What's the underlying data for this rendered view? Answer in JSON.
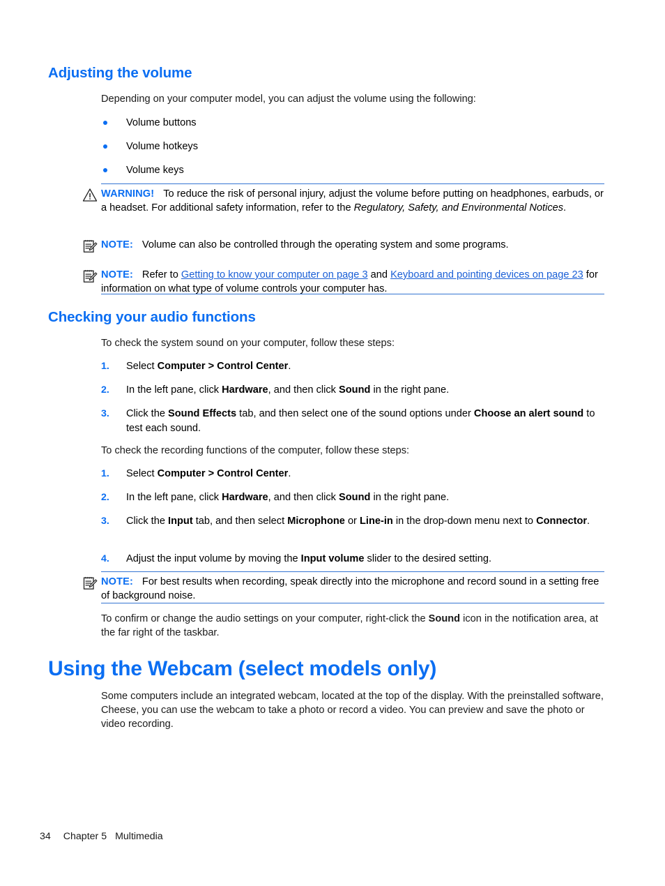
{
  "document": {
    "section1": {
      "heading": "Adjusting the volume",
      "intro": "Depending on your computer model, you can adjust the volume using the following:",
      "bullets": [
        "Volume buttons",
        "Volume hotkeys",
        "Volume keys"
      ],
      "warning": {
        "label": "WARNING!",
        "text_before_italic": "To reduce the risk of personal injury, adjust the volume before putting on headphones, earbuds, or a headset. For additional safety information, refer to the ",
        "italic_title": "Regulatory, Safety, and Environmental Notices",
        "text_after_italic": "."
      },
      "note1": {
        "label": "NOTE:",
        "text": "Volume can also be controlled through the operating system and some programs."
      },
      "note2": {
        "label": "NOTE:",
        "text_1": "Refer to ",
        "link_1": "Getting to know your computer on page 3",
        "text_2": " and ",
        "link_2": "Keyboard and pointing devices on page 23",
        "text_3": " for information on what type of volume controls your computer has."
      }
    },
    "section2": {
      "heading": "Checking your audio functions",
      "intro_system": "To check the system sound on your computer, follow these steps:",
      "steps_system": [
        {
          "num": "1.",
          "parts": [
            {
              "t": "Select ",
              "b": false
            },
            {
              "t": "Computer > Control Center",
              "b": true
            },
            {
              "t": ".",
              "b": false
            }
          ]
        },
        {
          "num": "2.",
          "parts": [
            {
              "t": "In the left pane, click ",
              "b": false
            },
            {
              "t": "Hardware",
              "b": true
            },
            {
              "t": ", and then click ",
              "b": false
            },
            {
              "t": "Sound",
              "b": true
            },
            {
              "t": " in the right pane.",
              "b": false
            }
          ]
        },
        {
          "num": "3.",
          "parts": [
            {
              "t": "Click the ",
              "b": false
            },
            {
              "t": "Sound Effects",
              "b": true
            },
            {
              "t": " tab, and then select one of the sound options under ",
              "b": false
            },
            {
              "t": "Choose an alert sound",
              "b": true
            },
            {
              "t": " to test each sound.",
              "b": false
            }
          ]
        }
      ],
      "intro_recording": "To check the recording functions of the computer, follow these steps:",
      "steps_recording": [
        {
          "num": "1.",
          "parts": [
            {
              "t": "Select ",
              "b": false
            },
            {
              "t": "Computer > Control Center",
              "b": true
            },
            {
              "t": ".",
              "b": false
            }
          ]
        },
        {
          "num": "2.",
          "parts": [
            {
              "t": "In the left pane, click ",
              "b": false
            },
            {
              "t": "Hardware",
              "b": true
            },
            {
              "t": ", and then click ",
              "b": false
            },
            {
              "t": "Sound",
              "b": true
            },
            {
              "t": " in the right pane.",
              "b": false
            }
          ]
        },
        {
          "num": "3.",
          "parts": [
            {
              "t": "Click the ",
              "b": false
            },
            {
              "t": "Input",
              "b": true
            },
            {
              "t": " tab, and then select ",
              "b": false
            },
            {
              "t": "Microphone",
              "b": true
            },
            {
              "t": " or ",
              "b": false
            },
            {
              "t": "Line-in",
              "b": true
            },
            {
              "t": " in the drop-down menu next to ",
              "b": false
            },
            {
              "t": "Connector",
              "b": true
            },
            {
              "t": ".",
              "b": false
            }
          ]
        },
        {
          "num": "4.",
          "parts": [
            {
              "t": "Adjust the input volume by moving the ",
              "b": false
            },
            {
              "t": "Input volume",
              "b": true
            },
            {
              "t": " slider to the desired setting.",
              "b": false
            }
          ]
        }
      ],
      "note3": {
        "label": "NOTE:",
        "text": "For best results when recording, speak directly into the microphone and record sound in a setting free of background noise."
      },
      "closing": {
        "parts": [
          {
            "t": "To confirm or change the audio settings on your computer, right-click the ",
            "b": false
          },
          {
            "t": "Sound",
            "b": true
          },
          {
            "t": " icon in the notification area, at the far right of the taskbar.",
            "b": false
          }
        ]
      }
    },
    "section3": {
      "heading": "Using the Webcam (select models only)",
      "paragraph": "Some computers include an integrated webcam, located at the top of the display. With the preinstalled software, Cheese, you can use the webcam to take a photo or record a video. You can preview and save the photo or video recording."
    },
    "footer": {
      "page_number": "34",
      "chapter": "Chapter 5",
      "chapter_title": "Multimedia"
    },
    "colors": {
      "accent_blue": "#0b6ef2",
      "link_blue": "#1a5fd6",
      "rule_blue": "#3575d3",
      "body_text": "#1a1a1a"
    },
    "icons": {
      "warning": "warning-triangle-icon",
      "note": "note-clipboard-icon"
    }
  }
}
